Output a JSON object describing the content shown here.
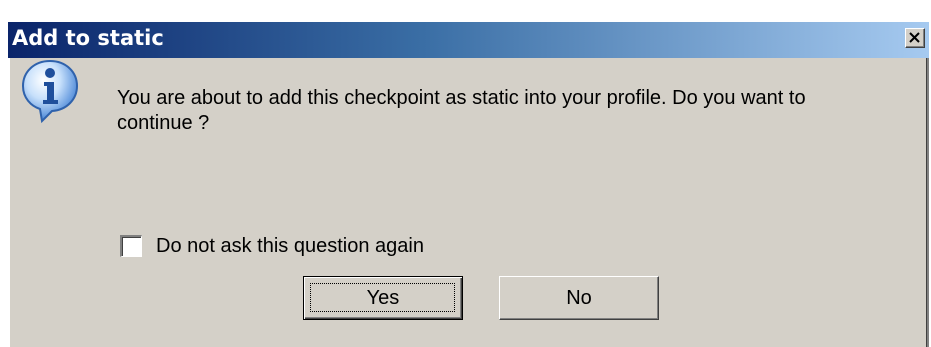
{
  "dialog": {
    "title": "Add to static",
    "close_icon": "close-icon",
    "message_icon": "info-icon",
    "message": "You are about to add this checkpoint as static into your profile. Do you want to continue ?",
    "checkbox": {
      "label": "Do not ask this question again",
      "checked": false
    },
    "buttons": {
      "yes": "Yes",
      "no": "No"
    }
  },
  "colors": {
    "title_gradient_start": "#0a246a",
    "title_gradient_end": "#a6caf0",
    "face": "#d4d0c8",
    "title_text": "#ffffff"
  }
}
